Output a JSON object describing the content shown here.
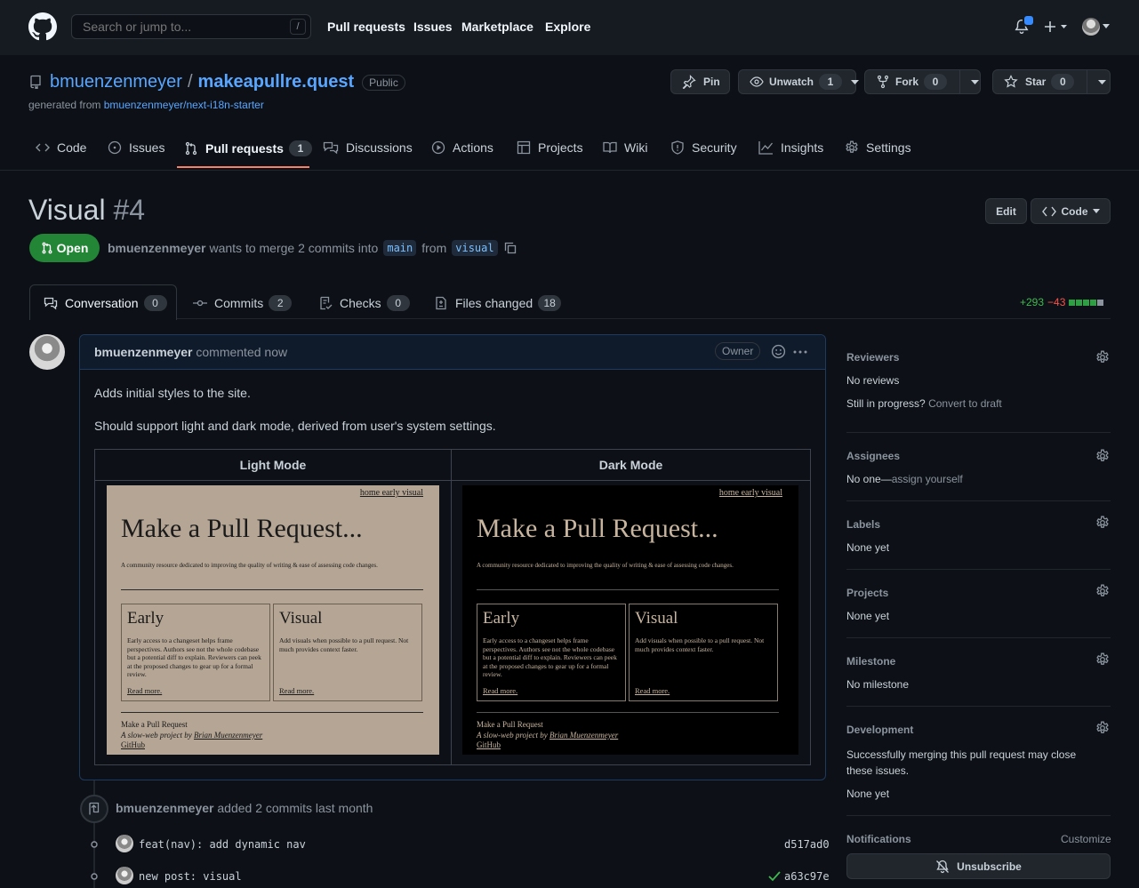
{
  "topbar": {
    "search_placeholder": "Search or jump to...",
    "search_key": "/",
    "nav": [
      "Pull requests",
      "Issues",
      "Marketplace",
      "Explore"
    ]
  },
  "repo": {
    "owner": "bmuenzenmeyer",
    "slash": "/",
    "name": "makeapullre.quest",
    "visibility": "Public",
    "generated_prefix": "generated from",
    "generated_from": "bmuenzenmeyer/next-i18n-starter",
    "pin": "Pin",
    "unwatch": "Unwatch",
    "unwatch_count": "1",
    "fork": "Fork",
    "fork_count": "0",
    "star": "Star",
    "star_count": "0"
  },
  "repo_tabs": [
    {
      "label": "Code"
    },
    {
      "label": "Issues"
    },
    {
      "label": "Pull requests",
      "count": "1"
    },
    {
      "label": "Discussions"
    },
    {
      "label": "Actions"
    },
    {
      "label": "Projects"
    },
    {
      "label": "Wiki"
    },
    {
      "label": "Security"
    },
    {
      "label": "Insights"
    },
    {
      "label": "Settings"
    }
  ],
  "pr": {
    "title": "Visual",
    "number": "#4",
    "edit": "Edit",
    "code": "Code",
    "state": "Open",
    "author": "bmuenzenmeyer",
    "merge_text": "wants to merge 2 commits into",
    "base": "main",
    "from_text": "from",
    "head": "visual",
    "additions": "+293",
    "deletions": "−43"
  },
  "pr_tabs": [
    {
      "label": "Conversation",
      "count": "0"
    },
    {
      "label": "Commits",
      "count": "2"
    },
    {
      "label": "Checks",
      "count": "0"
    },
    {
      "label": "Files changed",
      "count": "18"
    }
  ],
  "comment": {
    "author": "bmuenzenmeyer",
    "when": "commented now",
    "role": "Owner",
    "para1": "Adds initial styles to the site.",
    "para2": "Should support light and dark mode, derived from user's system settings.",
    "col1": "Light Mode",
    "col2": "Dark Mode"
  },
  "mock": {
    "nav": "home early visual",
    "title": "Make a Pull Request...",
    "subtitle": "A community resource dedicated to improving the quality of writing & ease of assessing code changes.",
    "card1_title": "Early",
    "card1_body": "Early access to a changeset helps frame perspectives. Authors see not the whole codebase but a potential diff to explain. Reviewers can peek at the proposed changes to gear up for a formal review.",
    "card2_title": "Visual",
    "card2_body": "Add visuals when possible to a pull request. Not much provides context faster.",
    "read_more": "Read more.",
    "footer1": "Make a Pull Request",
    "footer2_prefix": "A slow-web project by",
    "footer2_author": "Brian Muenzenmeyer",
    "footer3": "GitHub",
    "colors": {
      "light_bg": "#b4a594",
      "dark_bg": "#000000",
      "dark_text": "#c8b59f"
    }
  },
  "timeline": {
    "event_author": "bmuenzenmeyer",
    "event_text": "added 2 commits last month",
    "commits": [
      {
        "message": "feat(nav): add dynamic nav",
        "sha": "d517ad0"
      },
      {
        "message": "new post: visual",
        "sha": "a63c97e"
      }
    ]
  },
  "sidebar": {
    "reviewers_title": "Reviewers",
    "reviewers_value": "No reviews",
    "still_in_progress": "Still in progress?",
    "convert_to_draft": "Convert to draft",
    "assignees_title": "Assignees",
    "assignees_value": "No one—",
    "assign_yourself": "assign yourself",
    "labels_title": "Labels",
    "labels_value": "None yet",
    "projects_title": "Projects",
    "projects_value": "None yet",
    "milestone_title": "Milestone",
    "milestone_value": "No milestone",
    "development_title": "Development",
    "development_text": "Successfully merging this pull request may close these issues.",
    "development_value": "None yet",
    "notifications_title": "Notifications",
    "customize": "Customize",
    "unsubscribe": "Unsubscribe"
  },
  "colors": {
    "bg": "#0d1117",
    "header": "#161b22",
    "accent_link": "#58a6ff",
    "open_badge": "#238636",
    "tab_underline": "#f78166",
    "additions": "#3fb950",
    "deletions": "#f85149"
  }
}
